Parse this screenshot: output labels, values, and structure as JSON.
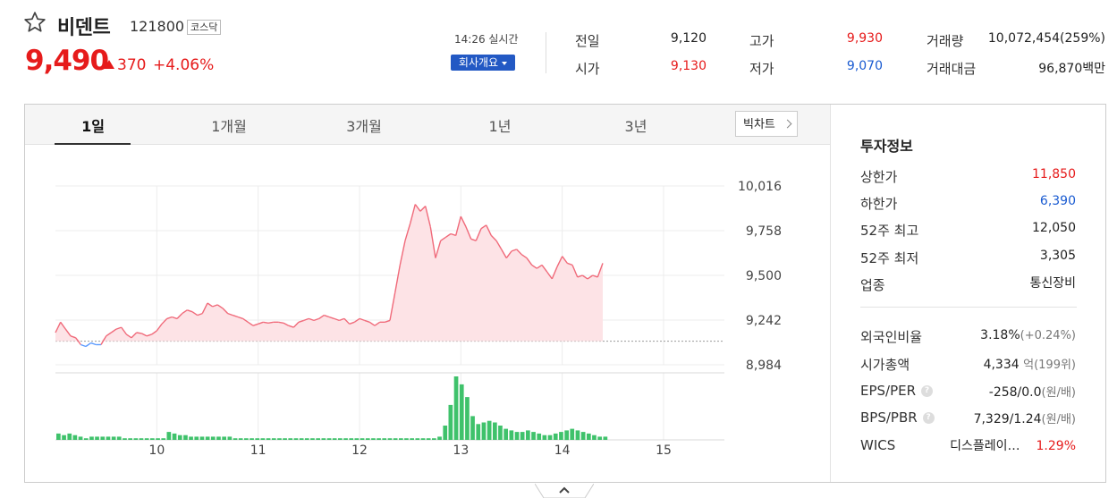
{
  "stock": {
    "name": "비덴트",
    "code": "121800",
    "market": "코스닥",
    "price": "9,490",
    "change": "370",
    "change_pct": "+4.06%",
    "realtime": "14:26 실시간",
    "company_btn": "회사개요"
  },
  "summary": [
    {
      "label": "전일",
      "value": "9,120",
      "color": "#222222"
    },
    {
      "label": "고가",
      "value": "9,930",
      "color": "#e61b1b"
    },
    {
      "label": "거래량",
      "value": "10,072,454(259%)",
      "color": "#222222"
    },
    {
      "label": "시가",
      "value": "9,130",
      "color": "#e61b1b"
    },
    {
      "label": "저가",
      "value": "9,070",
      "color": "#1a5bd1"
    },
    {
      "label": "거래대금",
      "value": "96,870백만",
      "color": "#222222"
    }
  ],
  "tabs": [
    "1일",
    "1개월",
    "3개월",
    "1년",
    "3년"
  ],
  "active_tab": "1일",
  "big_chart": "빅차트",
  "investment": {
    "title": "투자정보",
    "rows": [
      {
        "label": "상한가",
        "value": "11,850",
        "color": "#e61b1b"
      },
      {
        "label": "하한가",
        "value": "6,390",
        "color": "#1a5bd1"
      },
      {
        "label": "52주 최고",
        "value": "12,050",
        "color": "#222222"
      },
      {
        "label": "52주 최저",
        "value": "3,305",
        "color": "#222222"
      },
      {
        "label": "업종",
        "value": "통신장비",
        "color": "#222222"
      }
    ],
    "foreign": {
      "label": "외국인비율",
      "value": "3.18%",
      "sub": "(+0.24%)"
    },
    "mktcap": {
      "label": "시가총액",
      "value": "4,334",
      "unit": "억",
      "sub": "(199위)"
    },
    "eps": {
      "label": "EPS/PER",
      "value": "-258/0.0",
      "sub": "(원/배)"
    },
    "bps": {
      "label": "BPS/PBR",
      "value": "7,329/1.24",
      "sub": "(원/배)"
    },
    "wics": {
      "label": "WICS",
      "value": "디스플레이…",
      "pct": "1.29%"
    }
  },
  "colors": {
    "up": "#e61b1b",
    "down": "#1a5bd1",
    "volume": "#3fc26b",
    "line": "#f06a7a"
  },
  "chart_data": {
    "type": "line",
    "y_ticks": [
      "10,016",
      "9,758",
      "9,500",
      "9,242",
      "8,984"
    ],
    "ylim": [
      8984,
      10016
    ],
    "x_ticks": [
      "10",
      "11",
      "12",
      "13",
      "14",
      "15"
    ],
    "xlim": [
      9.0,
      15.6
    ],
    "base_price": 9120,
    "series": [
      {
        "values": [
          [
            9.0,
            9170
          ],
          [
            9.05,
            9230
          ],
          [
            9.1,
            9190
          ],
          [
            9.15,
            9150
          ],
          [
            9.2,
            9140
          ],
          [
            9.25,
            9100
          ],
          [
            9.3,
            9090
          ],
          [
            9.35,
            9110
          ],
          [
            9.4,
            9100
          ],
          [
            9.45,
            9100
          ],
          [
            9.5,
            9150
          ],
          [
            9.55,
            9170
          ],
          [
            9.6,
            9190
          ],
          [
            9.65,
            9200
          ],
          [
            9.7,
            9160
          ],
          [
            9.75,
            9140
          ],
          [
            9.8,
            9170
          ],
          [
            9.85,
            9165
          ],
          [
            9.9,
            9150
          ],
          [
            9.95,
            9160
          ],
          [
            10.0,
            9180
          ],
          [
            10.05,
            9220
          ],
          [
            10.1,
            9250
          ],
          [
            10.15,
            9260
          ],
          [
            10.2,
            9250
          ],
          [
            10.25,
            9280
          ],
          [
            10.3,
            9300
          ],
          [
            10.35,
            9290
          ],
          [
            10.4,
            9270
          ],
          [
            10.45,
            9280
          ],
          [
            10.5,
            9340
          ],
          [
            10.55,
            9320
          ],
          [
            10.6,
            9330
          ],
          [
            10.65,
            9310
          ],
          [
            10.7,
            9280
          ],
          [
            10.75,
            9270
          ],
          [
            10.8,
            9260
          ],
          [
            10.85,
            9250
          ],
          [
            10.9,
            9230
          ],
          [
            10.95,
            9210
          ],
          [
            11.0,
            9220
          ],
          [
            11.05,
            9230
          ],
          [
            11.1,
            9225
          ],
          [
            11.15,
            9230
          ],
          [
            11.2,
            9230
          ],
          [
            11.25,
            9225
          ],
          [
            11.3,
            9210
          ],
          [
            11.35,
            9200
          ],
          [
            11.4,
            9230
          ],
          [
            11.45,
            9240
          ],
          [
            11.5,
            9250
          ],
          [
            11.55,
            9240
          ],
          [
            11.6,
            9250
          ],
          [
            11.65,
            9270
          ],
          [
            11.7,
            9260
          ],
          [
            11.75,
            9250
          ],
          [
            11.8,
            9240
          ],
          [
            11.85,
            9250
          ],
          [
            11.9,
            9220
          ],
          [
            11.95,
            9230
          ],
          [
            12.0,
            9250
          ],
          [
            12.05,
            9240
          ],
          [
            12.1,
            9230
          ],
          [
            12.15,
            9210
          ],
          [
            12.2,
            9230
          ],
          [
            12.25,
            9230
          ],
          [
            12.3,
            9240
          ],
          [
            12.35,
            9400
          ],
          [
            12.4,
            9560
          ],
          [
            12.45,
            9700
          ],
          [
            12.5,
            9800
          ],
          [
            12.55,
            9910
          ],
          [
            12.6,
            9870
          ],
          [
            12.65,
            9900
          ],
          [
            12.7,
            9780
          ],
          [
            12.75,
            9600
          ],
          [
            12.8,
            9700
          ],
          [
            12.85,
            9720
          ],
          [
            12.9,
            9740
          ],
          [
            12.95,
            9730
          ],
          [
            13.0,
            9840
          ],
          [
            13.05,
            9780
          ],
          [
            13.1,
            9710
          ],
          [
            13.15,
            9700
          ],
          [
            13.2,
            9770
          ],
          [
            13.25,
            9790
          ],
          [
            13.3,
            9730
          ],
          [
            13.35,
            9700
          ],
          [
            13.4,
            9650
          ],
          [
            13.45,
            9600
          ],
          [
            13.5,
            9640
          ],
          [
            13.55,
            9650
          ],
          [
            13.6,
            9620
          ],
          [
            13.65,
            9600
          ],
          [
            13.7,
            9560
          ],
          [
            13.75,
            9540
          ],
          [
            13.8,
            9560
          ],
          [
            13.85,
            9520
          ],
          [
            13.9,
            9480
          ],
          [
            13.95,
            9550
          ],
          [
            14.0,
            9610
          ],
          [
            14.05,
            9570
          ],
          [
            14.1,
            9560
          ],
          [
            14.15,
            9490
          ],
          [
            14.2,
            9500
          ],
          [
            14.25,
            9480
          ],
          [
            14.3,
            9500
          ],
          [
            14.35,
            9490
          ],
          [
            14.4,
            9570
          ]
        ]
      }
    ],
    "volume": [
      4,
      3,
      4,
      3,
      2,
      1,
      2,
      2,
      2,
      2,
      2,
      2,
      1,
      1,
      1,
      1,
      1,
      1,
      1,
      1,
      5,
      4,
      3,
      3,
      2,
      2,
      2,
      2,
      2,
      2,
      2,
      2,
      1,
      1,
      1,
      1,
      1,
      1,
      1,
      1,
      1,
      1,
      1,
      1,
      1,
      1,
      1,
      1,
      1,
      1,
      1,
      1,
      1,
      1,
      1,
      1,
      1,
      1,
      1,
      1,
      1,
      1,
      1,
      1,
      1,
      1,
      1,
      1,
      1,
      2,
      9,
      22,
      40,
      35,
      27,
      15,
      10,
      11,
      12,
      11,
      9,
      7,
      6,
      5,
      5,
      6,
      5,
      4,
      3,
      3,
      4,
      5,
      6,
      7,
      6,
      5,
      4,
      3,
      2,
      2
    ]
  }
}
